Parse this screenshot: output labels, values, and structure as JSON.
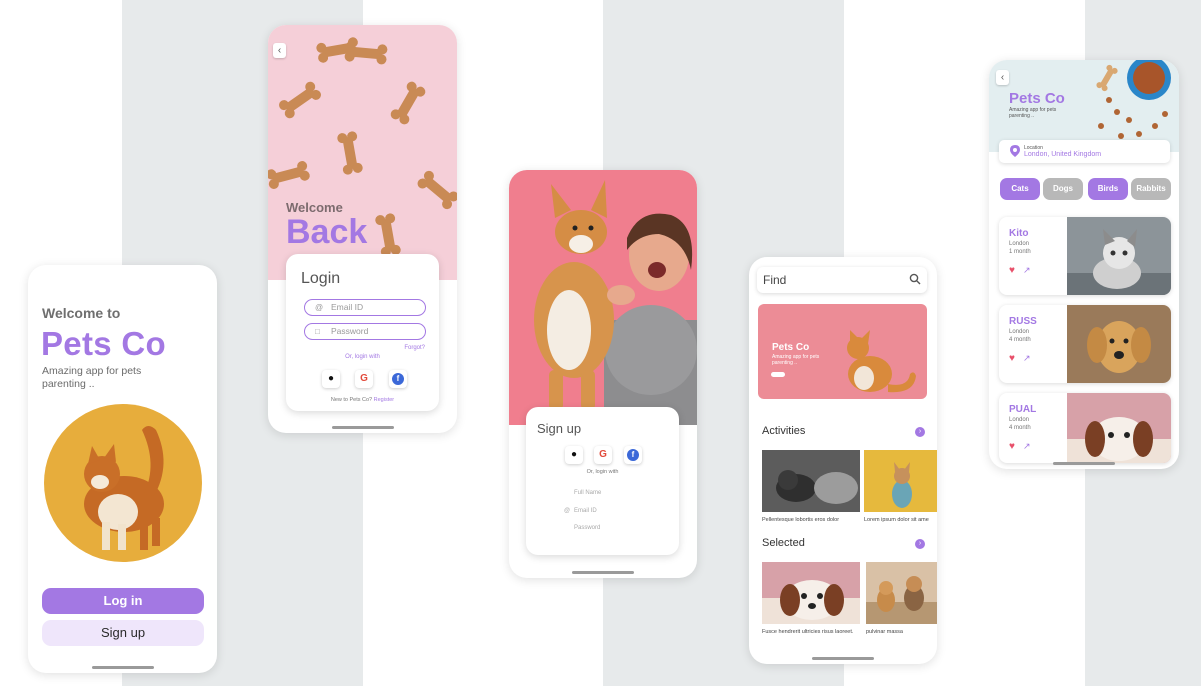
{
  "colors": {
    "accent": "#a378e3",
    "accent_light": "#efe6fb",
    "stripe": "#e7eaeb",
    "chip_inactive": "#b8b8b8"
  },
  "welcome_screen": {
    "heading": "Welcome to",
    "brand": "Pets Co",
    "tagline": "Amazing app for pets parenting ..",
    "login_label": "Log in",
    "signup_label": "Sign up"
  },
  "login_screen": {
    "welcome": "Welcome",
    "back": "Back",
    "title": "Login",
    "email_placeholder": "Email ID",
    "password_placeholder": "Password",
    "forgot": "Forgot?",
    "or_login_with": "Or, login with",
    "new_to": "New to Pets Co?",
    "register": "Register"
  },
  "signup_screen": {
    "title": "Sign up",
    "or_login_with": "Or, login with",
    "full_name": "Full Name",
    "email": "Email ID",
    "password": "Password"
  },
  "explore_screen": {
    "search_placeholder": "Find",
    "banner_title": "Pets Co",
    "banner_subtitle": "Amazing app for pets parenting ..",
    "activities_title": "Activities",
    "activities": [
      {
        "caption": "Pellentesque lobortis eros dolor"
      },
      {
        "caption": "Lorem ipsum dolor sit ame"
      }
    ],
    "selected_title": "Selected",
    "selected": [
      {
        "caption": "Fusce hendrerit ultricies risus laoreet."
      },
      {
        "caption": "pulvinar massa"
      }
    ]
  },
  "listing_screen": {
    "brand": "Pets Co",
    "tagline": "Amazing app for pets parenting ..",
    "location_label": "Location",
    "location_value": "London, United Kingdom",
    "chips": [
      "Cats",
      "Dogs",
      "Birds",
      "Rabbits"
    ],
    "pets": [
      {
        "name": "Kito",
        "city": "London",
        "age": "1 month"
      },
      {
        "name": "RUSS",
        "city": "London",
        "age": "4 month"
      },
      {
        "name": "PUAL",
        "city": "London",
        "age": "4 month"
      }
    ]
  }
}
